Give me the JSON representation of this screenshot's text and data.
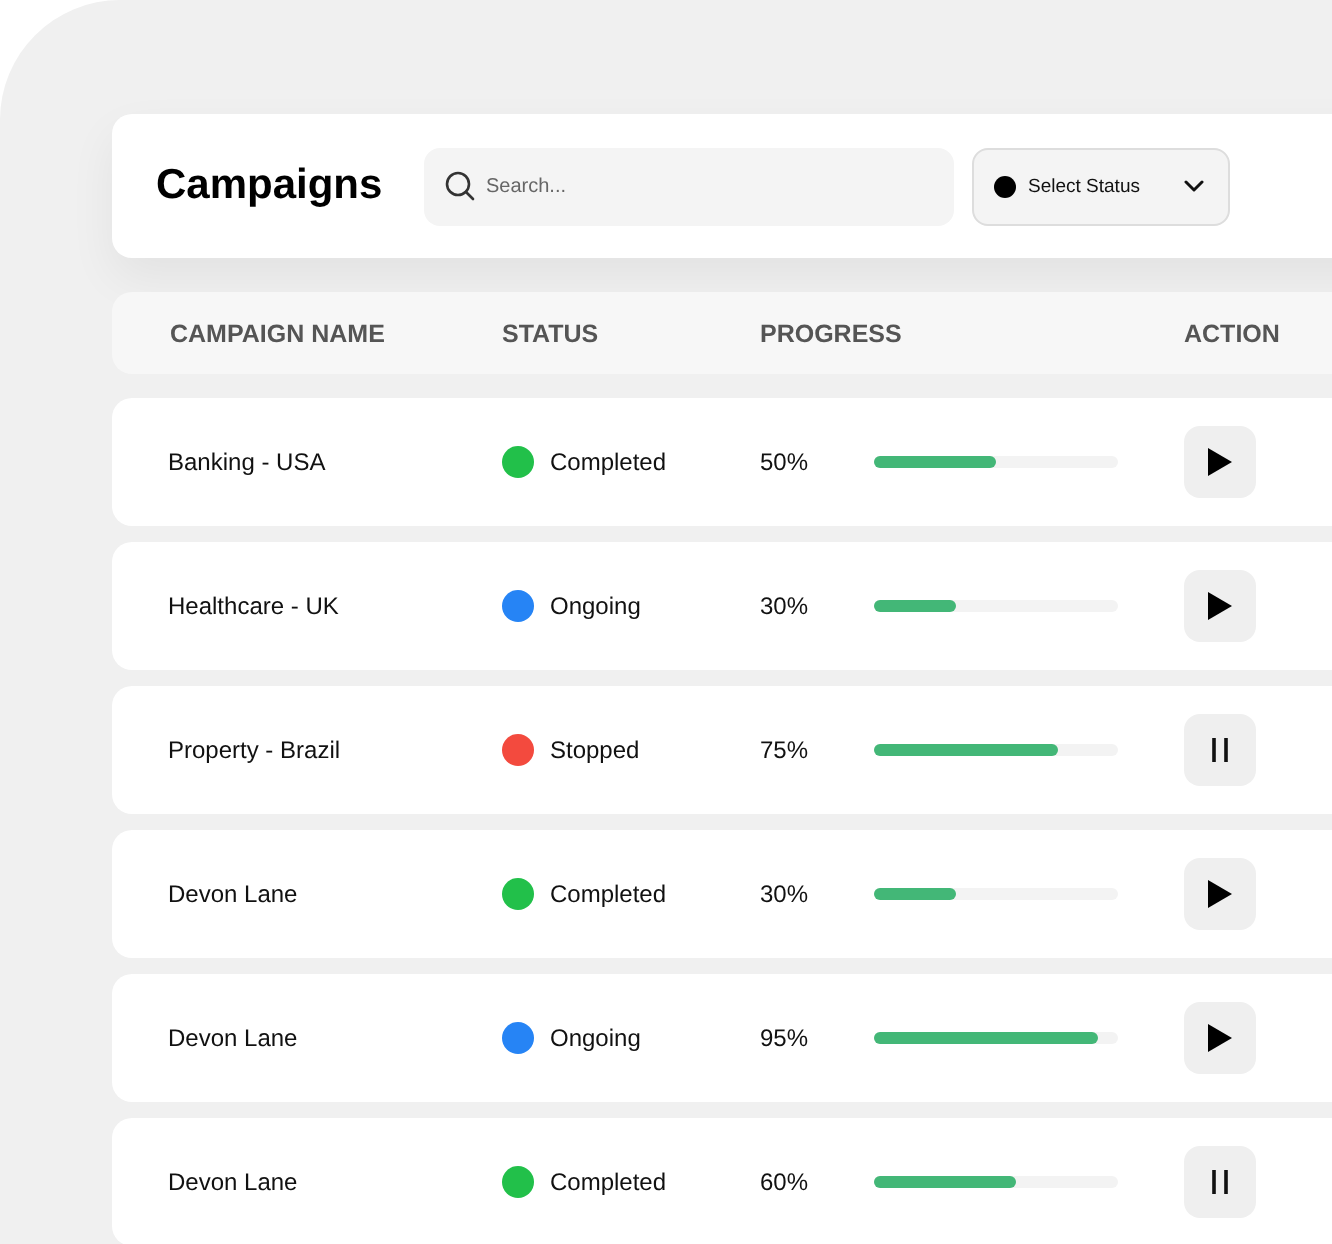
{
  "header": {
    "title": "Campaigns",
    "search": {
      "placeholder": "Search..."
    },
    "status_filter": {
      "label": "Select Status"
    }
  },
  "table": {
    "columns": [
      "CAMPAIGN NAME",
      "STATUS",
      "PROGRESS",
      "ACTION"
    ],
    "rows": [
      {
        "name": "Banking - USA",
        "status": "Completed",
        "color": "#22c04a",
        "progress": "50%",
        "level": 0.5,
        "kind": "play"
      },
      {
        "name": "Healthcare - UK",
        "status": "Ongoing",
        "color": "#2684f5",
        "progress": "30%",
        "level": 0.34,
        "kind": "play"
      },
      {
        "name": "Property - Brazil",
        "status": "Stopped",
        "color": "#f34a3e",
        "progress": "75%",
        "level": 0.75,
        "kind": "pause"
      },
      {
        "name": "Devon Lane",
        "status": "Completed",
        "color": "#22c04a",
        "progress": "30%",
        "level": 0.34,
        "kind": "play"
      },
      {
        "name": "Devon Lane",
        "status": "Ongoing",
        "color": "#2684f5",
        "progress": "95%",
        "level": 0.92,
        "kind": "play"
      },
      {
        "name": "Devon Lane",
        "status": "Completed",
        "color": "#22c04a",
        "progress": "60%",
        "level": 0.58,
        "kind": "pause"
      }
    ]
  }
}
